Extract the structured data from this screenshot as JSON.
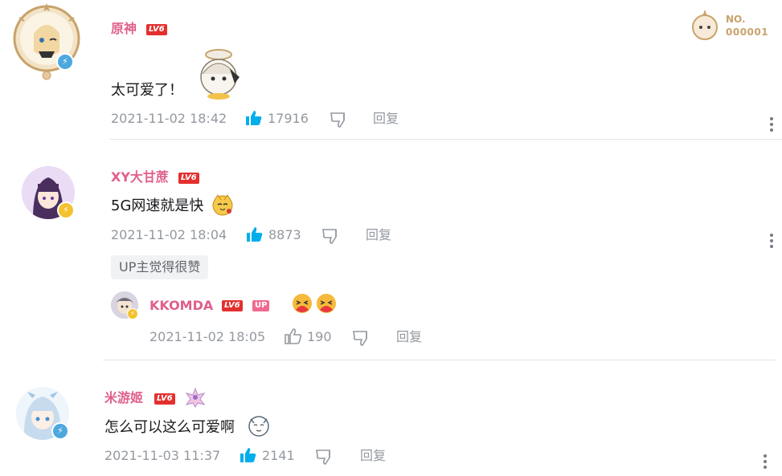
{
  "comments": [
    {
      "username": "原神",
      "level": "LV6",
      "text": "太可爱了！",
      "date": "2021-11-02 18:42",
      "likes": "17916",
      "reply_label": "回复"
    },
    {
      "username": "XY大甘蔗",
      "level": "LV6",
      "text": "5G网速就是快",
      "date": "2021-11-02 18:04",
      "likes": "8873",
      "reply_label": "回复",
      "tag": "UP主觉得很赞",
      "sub_reply": {
        "username": "KKOMDA",
        "level": "LV6",
        "up_badge": "UP",
        "date": "2021-11-02 18:05",
        "likes": "190",
        "reply_label": "回复"
      }
    },
    {
      "username": "米游姬",
      "level": "LV6",
      "text": "怎么可以这么可爱啊",
      "date": "2021-11-03 11:37",
      "likes": "2141",
      "reply_label": "回复"
    }
  ],
  "fan_badge": {
    "label": "NO.",
    "number": "000001"
  },
  "colors": {
    "username": "#e05f8c",
    "like_active": "#00aeec",
    "meta": "#9499a0",
    "level": "#e3302e"
  },
  "icons": [
    "thumbs-up-icon",
    "thumbs-down-icon",
    "more-vertical-icon",
    "verified-bolt-icon",
    "sticker-icon"
  ]
}
